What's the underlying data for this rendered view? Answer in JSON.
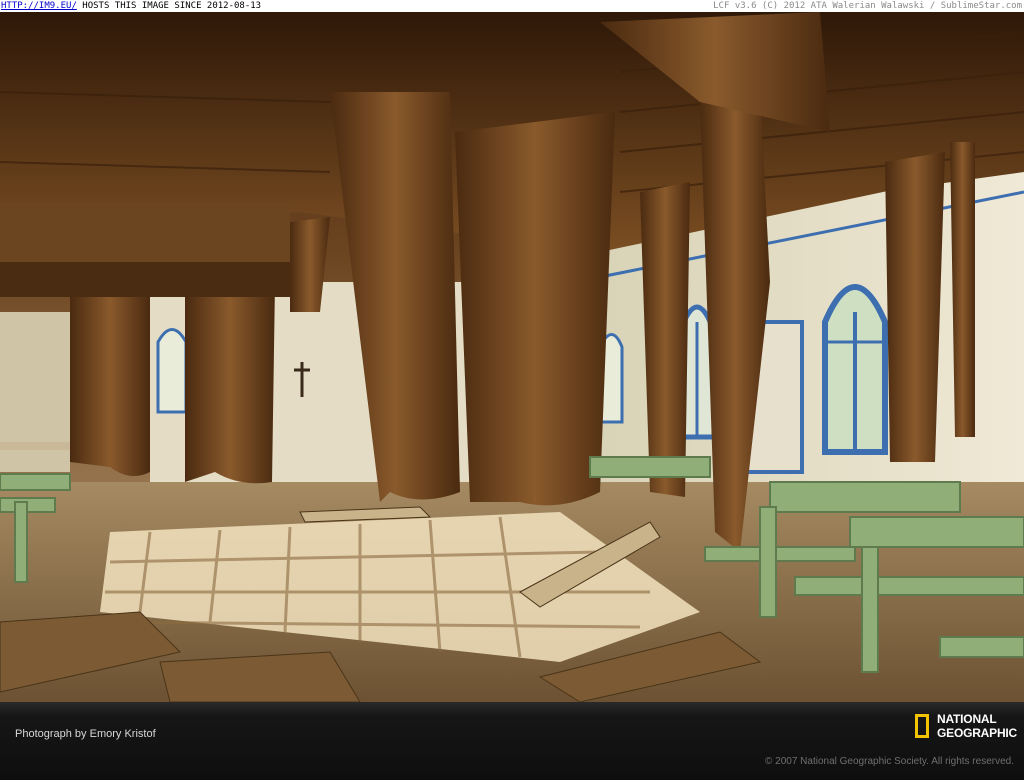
{
  "host_bar": {
    "link_text": "HTTP://IM9.EU/",
    "host_notice": "HOSTS THIS IMAGE SINCE 2012-08-13",
    "right_text": "LCF v3.6 (C) 2012 ATA Walerian Walawski / SublimeStar.com"
  },
  "caption": {
    "credit": "Photograph by Emory Kristof",
    "copyright": "© 2007 National Geographic Society. All rights reserved."
  },
  "logo": {
    "line1": "NATIONAL",
    "line2": "GEOGRAPHIC",
    "border_color": "#f2c300"
  },
  "colors": {
    "wood_dark": "#3a200b",
    "wood_mid": "#7a4f24",
    "wall": "#e9e6d2",
    "window_frame": "#3d6fb0",
    "bench_green": "#8fae78",
    "sunlight": "#f6ead0"
  }
}
